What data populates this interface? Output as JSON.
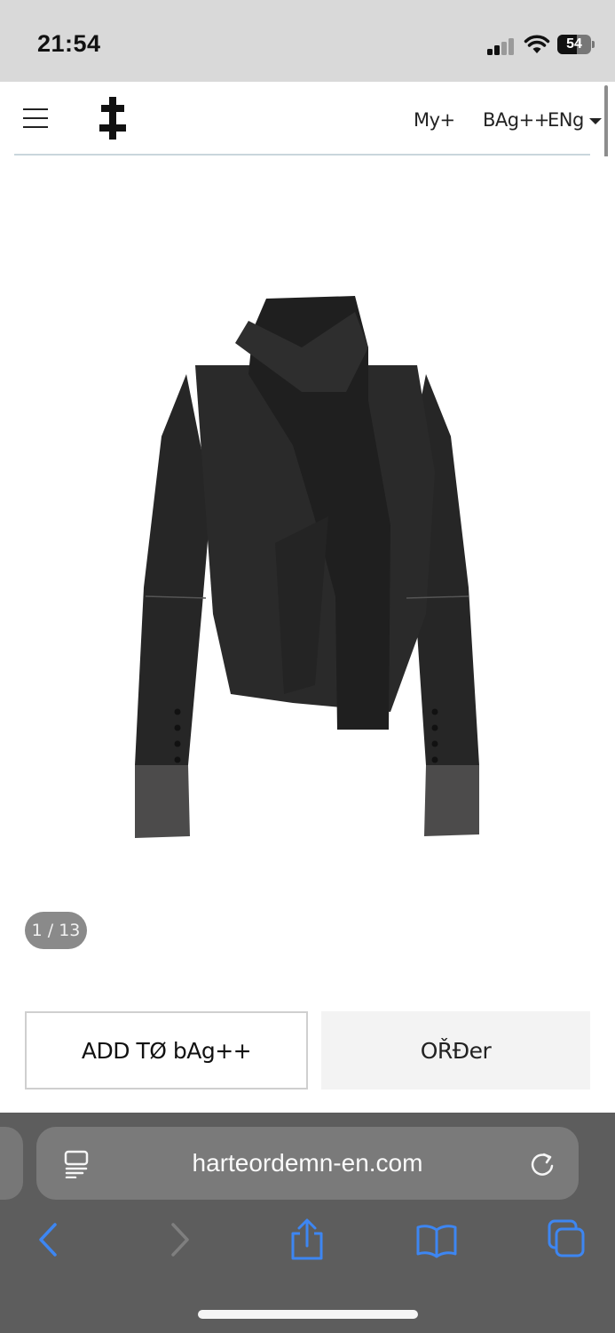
{
  "status_bar": {
    "time": "21:54",
    "battery_percent": "54"
  },
  "header": {
    "nav_my": "My+",
    "nav_bag": "BAg++",
    "nav_lang": "ENg"
  },
  "product": {
    "image_counter": "1 / 13"
  },
  "actions": {
    "add_to_bag": "ADD TØ bAg++",
    "order": "OŘĐer"
  },
  "browser": {
    "url": "harteordemn-en.com"
  },
  "colors": {
    "status_bg": "#d9d9d9",
    "browser_bg": "#5d5d5d",
    "link_blue": "#3d86f2",
    "garment": "#232323"
  }
}
